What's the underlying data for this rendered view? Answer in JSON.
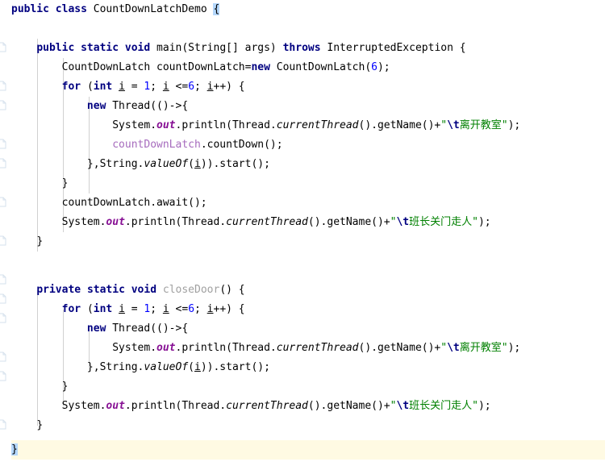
{
  "app": {
    "name": "IntelliJ IDEA Java Editor",
    "language": "Java",
    "class_name": "CountDownLatchDemo"
  },
  "theme": {
    "background": "#ffffff",
    "foreground": "#000000",
    "keyword": "#000080",
    "number": "#0000ff",
    "string": "#008000",
    "escape": "#000080",
    "static_field": "#871094",
    "unused_method": "#a0a0a0",
    "captured_var": "#9876aa",
    "current_line_highlight": "#fffae3",
    "matching_brace_highlight": "#b4d7fb",
    "indent_guide": "#d0d0d0"
  },
  "gutter": {
    "icon_name": "code-fold-marker-icon",
    "marker_rows": [
      2,
      4,
      5,
      8,
      9,
      11,
      13,
      14,
      15,
      17,
      18,
      21,
      22
    ]
  },
  "code": {
    "lines": [
      {
        "n": 1,
        "indent": 0,
        "text": "public class CountDownLatchDemo {"
      },
      {
        "n": 2,
        "indent": 0,
        "text": ""
      },
      {
        "n": 3,
        "indent": 1,
        "text": "public static void main(String[] args) throws InterruptedException {"
      },
      {
        "n": 4,
        "indent": 2,
        "text": "CountDownLatch countDownLatch=new CountDownLatch(6);"
      },
      {
        "n": 5,
        "indent": 2,
        "text": "for (int i = 1; i <=6; i++) {"
      },
      {
        "n": 6,
        "indent": 3,
        "text": "new Thread(()->{"
      },
      {
        "n": 7,
        "indent": 4,
        "text": "System.out.println(Thread.currentThread().getName()+\"\\t离开教室\");"
      },
      {
        "n": 8,
        "indent": 4,
        "text": "countDownLatch.countDown();"
      },
      {
        "n": 9,
        "indent": 3,
        "text": "},String.valueOf(i)).start();"
      },
      {
        "n": 10,
        "indent": 2,
        "text": "}"
      },
      {
        "n": 11,
        "indent": 2,
        "text": "countDownLatch.await();"
      },
      {
        "n": 12,
        "indent": 2,
        "text": "System.out.println(Thread.currentThread().getName()+\"\\t班长关门走人\");"
      },
      {
        "n": 13,
        "indent": 1,
        "text": "}"
      },
      {
        "n": 14,
        "indent": 0,
        "text": ""
      },
      {
        "n": 15,
        "indent": 1,
        "text": "private static void closeDoor() {"
      },
      {
        "n": 16,
        "indent": 2,
        "text": "for (int i = 1; i <=6; i++) {"
      },
      {
        "n": 17,
        "indent": 3,
        "text": "new Thread(()->{"
      },
      {
        "n": 18,
        "indent": 4,
        "text": "System.out.println(Thread.currentThread().getName()+\"\\t离开教室\");"
      },
      {
        "n": 19,
        "indent": 3,
        "text": "},String.valueOf(i)).start();"
      },
      {
        "n": 20,
        "indent": 2,
        "text": "}"
      },
      {
        "n": 21,
        "indent": 2,
        "text": "System.out.println(Thread.currentThread().getName()+\"\\t班长关门走人\");"
      },
      {
        "n": 22,
        "indent": 1,
        "text": "}"
      },
      {
        "n": 23,
        "indent": 0,
        "text": "}"
      }
    ],
    "strings": {
      "leave_classroom": "\\t离开教室",
      "monitor_closes_door": "\\t班长关门走人"
    },
    "identifiers": {
      "class": "CountDownLatchDemo",
      "main_method": "main",
      "unused_method": "closeDoor",
      "latch_var": "countDownLatch",
      "latch_type": "CountDownLatch",
      "latch_count": "6",
      "loop_var": "i",
      "loop_start": "1",
      "loop_limit": "6",
      "thread_type": "Thread",
      "exception": "InterruptedException"
    }
  }
}
